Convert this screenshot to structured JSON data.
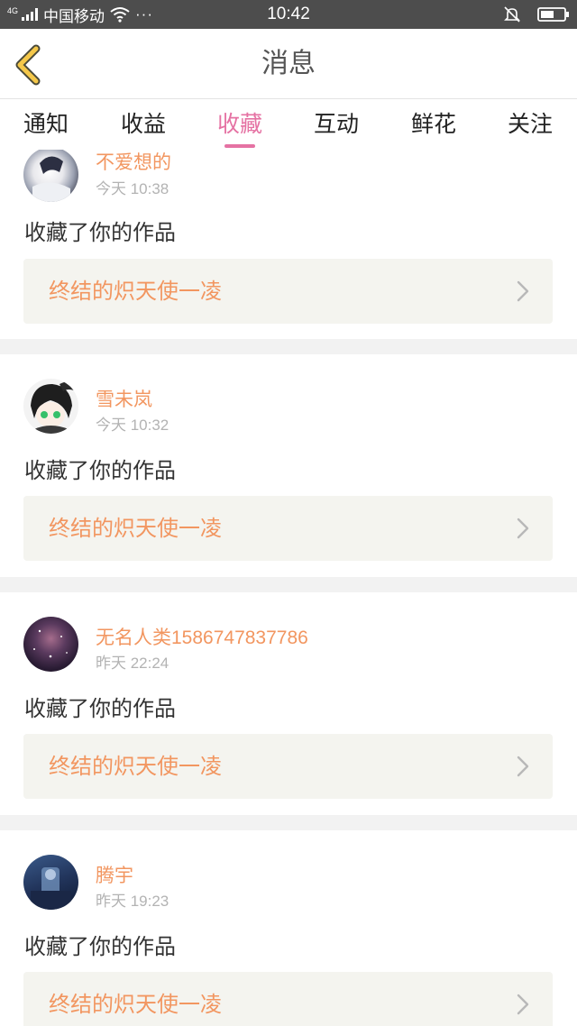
{
  "status_bar": {
    "network_type": "4G",
    "carrier": "中国移动",
    "more": "···",
    "time": "10:42"
  },
  "header": {
    "title": "消息",
    "back_icon": "chevron-left-icon"
  },
  "tabs": [
    {
      "label": "通知",
      "active": false
    },
    {
      "label": "收益",
      "active": false
    },
    {
      "label": "收藏",
      "active": true
    },
    {
      "label": "互动",
      "active": false
    },
    {
      "label": "鲜花",
      "active": false
    },
    {
      "label": "关注",
      "active": false
    }
  ],
  "colors": {
    "accent": "#e572a3",
    "name": "#f29660",
    "time": "#b3b3b3",
    "box_bg": "#f4f4ef",
    "separator": "#f2f2f2"
  },
  "messages": [
    {
      "username": "不爱想的",
      "time": "今天 10:38",
      "action": "收藏了你的作品",
      "work_title": "终结的炽天使一凌"
    },
    {
      "username": "雪未岚",
      "time": "今天 10:32",
      "action": "收藏了你的作品",
      "work_title": "终结的炽天使一凌"
    },
    {
      "username": "无名人类1586747837786",
      "time": "昨天 22:24",
      "action": "收藏了你的作品",
      "work_title": "终结的炽天使一凌"
    },
    {
      "username": "腾宇",
      "time": "昨天 19:23",
      "action": "收藏了你的作品",
      "work_title": "终结的炽天使一凌"
    }
  ]
}
